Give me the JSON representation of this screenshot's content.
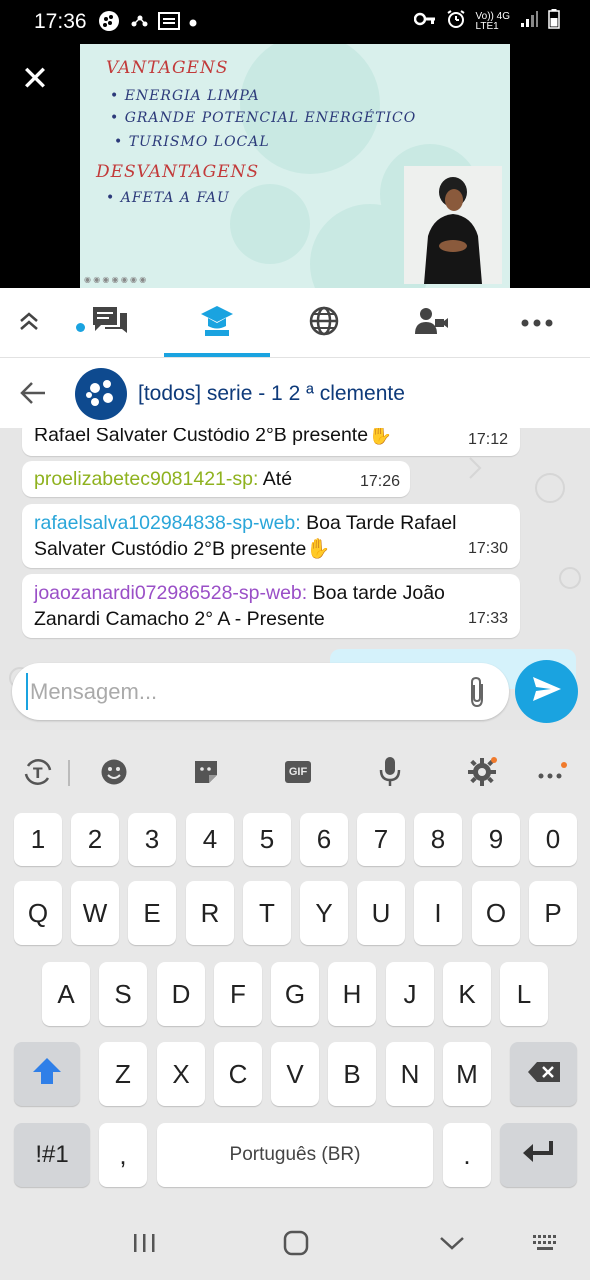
{
  "status_bar": {
    "time": "17:36",
    "network_label_top": "Vo)) 4G",
    "network_label_bottom": "LTE1"
  },
  "video": {
    "slide_lines": [
      "VANTAGENS",
      "• ENERGIA LIMPA",
      "• GRANDE POTENCIAL ENERGÉTICO",
      "• TURISMO LOCAL",
      "DESVANTAGENS",
      "• AFETA A FAU"
    ]
  },
  "tabs": [
    {
      "name": "collapse",
      "icon": "double-chevron-up-icon"
    },
    {
      "name": "chat",
      "icon": "chat-bubbles-icon"
    },
    {
      "name": "class",
      "icon": "graduation-cap-icon",
      "active": true
    },
    {
      "name": "web",
      "icon": "globe-icon"
    },
    {
      "name": "video-call",
      "icon": "video-person-icon"
    },
    {
      "name": "more",
      "icon": "more-dots-icon"
    }
  ],
  "chat_header": {
    "title": "[todos] serie - 1 2 ª clemente"
  },
  "messages": [
    {
      "user": "",
      "user_color": "#2aa6d9",
      "text": "Rafael Salvater Custódio 2°B presente✋",
      "time": "17:12"
    },
    {
      "user": "proelizabetec9081421-sp:",
      "user_color": "#8fb21f",
      "text": "Até",
      "time": "17:26"
    },
    {
      "user": "rafaelsalva102984838-sp-web:",
      "user_color": "#2aa6d9",
      "text": "Boa Tarde Rafael Salvater Custódio 2°B presente✋",
      "time": "17:30"
    },
    {
      "user": "joaozanardi072986528-sp-web:",
      "user_color": "#9a4fc7",
      "text": "Boa tarde João Zanardi Camacho  2° A - Presente",
      "time": "17:33"
    }
  ],
  "composer": {
    "placeholder": "Mensagem..."
  },
  "keyboard": {
    "toolbar": [
      "text-mode-icon",
      "emoji-icon",
      "sticker-icon",
      "gif-icon",
      "mic-icon",
      "settings-icon",
      "more-icon"
    ],
    "gif_label": "GIF",
    "row_numbers": [
      "1",
      "2",
      "3",
      "4",
      "5",
      "6",
      "7",
      "8",
      "9",
      "0"
    ],
    "row1": [
      "Q",
      "W",
      "E",
      "R",
      "T",
      "Y",
      "U",
      "I",
      "O",
      "P"
    ],
    "row2": [
      "A",
      "S",
      "D",
      "F",
      "G",
      "H",
      "J",
      "K",
      "L"
    ],
    "row3": [
      "Z",
      "X",
      "C",
      "V",
      "B",
      "N",
      "M"
    ],
    "symbols_label": "!#1",
    "comma_label": ",",
    "space_label": "Português (BR)",
    "period_label": "."
  },
  "colors": {
    "accent": "#1aa3e0",
    "title": "#0e3a7a"
  }
}
